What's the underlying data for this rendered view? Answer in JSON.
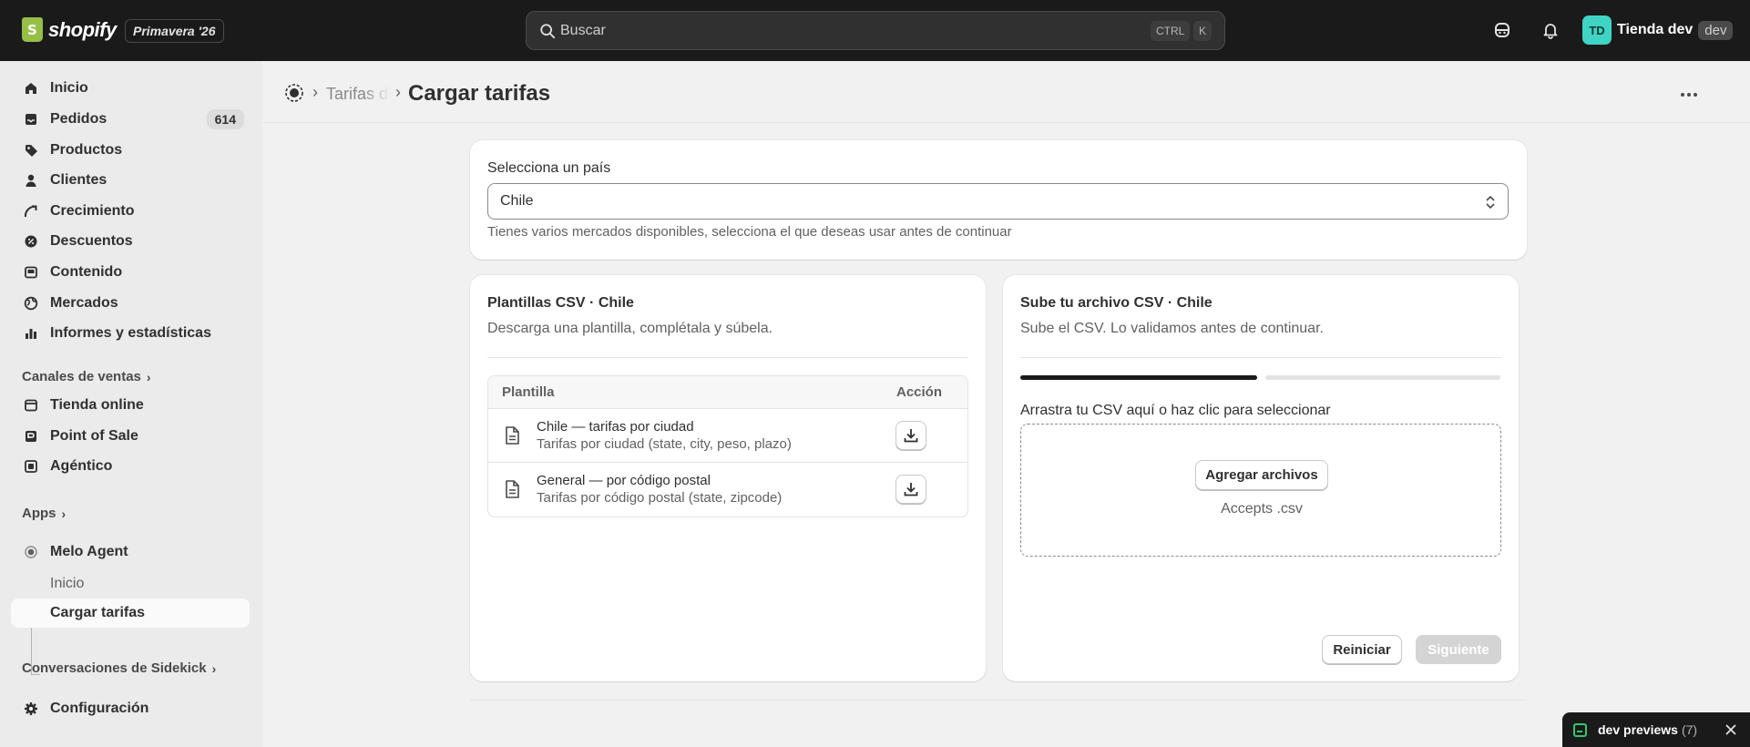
{
  "topbar": {
    "logo_text": "shopify",
    "edition": "Primavera '26",
    "search_placeholder": "Buscar",
    "kbd_ctrl": "CTRL",
    "kbd_k": "K",
    "store_initials": "TD",
    "store_name": "Tienda dev",
    "store_tag": "dev"
  },
  "sidebar": {
    "main": [
      {
        "label": "Inicio",
        "icon": "home-icon"
      },
      {
        "label": "Pedidos",
        "icon": "inbox-icon",
        "badge": "614"
      },
      {
        "label": "Productos",
        "icon": "tag-icon"
      },
      {
        "label": "Clientes",
        "icon": "person-icon"
      },
      {
        "label": "Crecimiento",
        "icon": "growth-icon"
      },
      {
        "label": "Descuentos",
        "icon": "discount-icon"
      },
      {
        "label": "Contenido",
        "icon": "content-icon"
      },
      {
        "label": "Mercados",
        "icon": "globe-icon"
      },
      {
        "label": "Informes y estadísticas",
        "icon": "chart-icon"
      }
    ],
    "sales_channels_heading": "Canales de ventas",
    "channels": [
      {
        "label": "Tienda online",
        "icon": "store-icon"
      },
      {
        "label": "Point of Sale",
        "icon": "pos-icon"
      },
      {
        "label": "Agéntico",
        "icon": "agent-icon"
      }
    ],
    "apps_heading": "Apps",
    "app": {
      "label": "Melo Agent",
      "icon": "app-icon"
    },
    "app_subitems": [
      "Inicio",
      "Cargar tarifas"
    ],
    "sidekick_heading": "Conversaciones de Sidekick",
    "settings": {
      "label": "Configuración",
      "icon": "gear-icon"
    }
  },
  "header": {
    "breadcrumb_prev": "Tarifas de envío",
    "title": "Cargar tarifas"
  },
  "country": {
    "label": "Selecciona un país",
    "value": "Chile",
    "help": "Tienes varios mercados disponibles, selecciona el que deseas usar antes de continuar"
  },
  "templates": {
    "title": "Plantillas CSV · Chile",
    "subtitle": "Descarga una plantilla, complétala y súbela.",
    "columns": [
      "Plantilla",
      "Acción"
    ],
    "rows": [
      {
        "name": "Chile — tarifas por ciudad",
        "desc": "Tarifas por ciudad (state, city, peso, plazo)"
      },
      {
        "name": "General — por código postal",
        "desc": "Tarifas por código postal (state, zipcode)"
      }
    ]
  },
  "upload": {
    "title": "Sube tu archivo CSV · Chile",
    "subtitle": "Sube el CSV. Lo validamos antes de continuar.",
    "progress_step": 1,
    "progress_total": 2,
    "drop_label": "Arrastra tu CSV aquí o haz clic para seleccionar",
    "add_button": "Agregar archivos",
    "accepts": "Accepts .csv",
    "reset_button": "Reiniciar",
    "next_button": "Siguiente"
  },
  "dev_bar": {
    "label": "dev previews",
    "count": "(7)"
  },
  "colors": {
    "topbar": "#1a1a1a",
    "accent_avatar": "#3fd4c4",
    "dev_status": "#36c46c"
  }
}
